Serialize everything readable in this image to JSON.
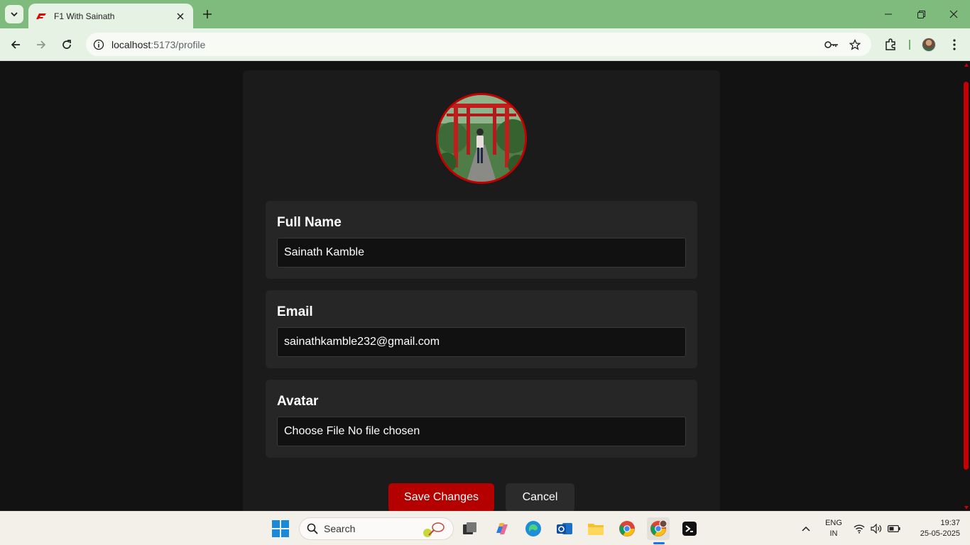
{
  "browser": {
    "tab_title": "F1 With Sainath",
    "url_host": "localhost",
    "url_path": ":5173/profile",
    "icons": [
      "tab-search-icon",
      "f1-favicon",
      "close-icon",
      "new-tab-icon",
      "minimize-icon",
      "restore-icon",
      "close-window-icon",
      "back-icon",
      "forward-icon",
      "reload-icon",
      "site-info-icon",
      "password-key-icon",
      "bookmark-star-icon",
      "extensions-icon",
      "profile-avatar",
      "more-menu-icon"
    ]
  },
  "profile": {
    "avatar_alt": "",
    "fields": [
      {
        "label": "Full Name",
        "value": "Sainath Kamble"
      },
      {
        "label": "Email",
        "value": "sainathkamble232@gmail.com"
      },
      {
        "label": "Avatar",
        "file_button": "Choose File",
        "file_status": "No file chosen"
      }
    ],
    "save_label": "Save Changes",
    "cancel_label": "Cancel"
  },
  "taskbar": {
    "search_placeholder": "Search",
    "language": "ENG",
    "region": "IN",
    "time": "19:37",
    "date": "25-05-2025"
  },
  "colors": {
    "accent": "#b50000",
    "page_bg": "#121212",
    "card_bg": "#1b1b1b",
    "field_bg": "#262626",
    "chrome_green": "#7fbb7d"
  }
}
